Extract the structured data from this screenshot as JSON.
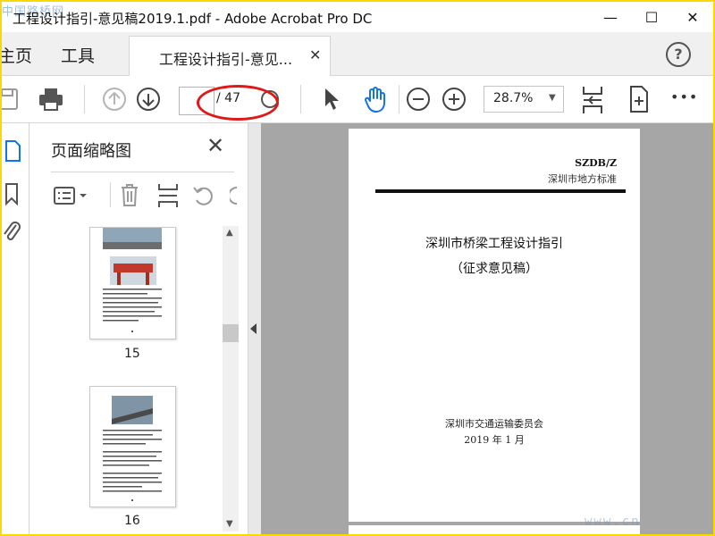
{
  "window": {
    "title": "工程设计指引-意见稿2019.1.pdf - Adobe Acrobat Pro DC",
    "minimize_glyph": "—",
    "maximize_glyph": "☐",
    "close_glyph": "✕",
    "watermark_logo": "中国路桥网"
  },
  "menu": {
    "home": "主页",
    "tools": "工具"
  },
  "tab": {
    "label": "工程设计指引-意见...",
    "close_glyph": "✕"
  },
  "help": {
    "glyph": "?"
  },
  "toolbar": {
    "page_current": "",
    "page_total": "/ 47",
    "zoom": "28.7%",
    "zoom_arrow": "▼",
    "more_glyph": "•••"
  },
  "panel": {
    "title": "页面缩略图",
    "close_glyph": "✕",
    "thumbnails": [
      {
        "label": "15"
      },
      {
        "label": "16"
      }
    ],
    "scroll_up_glyph": "▲",
    "scroll_down_glyph": "▼"
  },
  "document": {
    "code": "SZDB/Z",
    "standard": "深圳市地方标准",
    "title": "深圳市桥梁工程设计指引",
    "subtitle": "（征求意见稿）",
    "org": "深圳市交通运输委员会",
    "date": "2019 年 1 月"
  },
  "watermark_url": "www.cn",
  "colors": {
    "frame": "#f8d900",
    "accent_blue": "#1473e6",
    "annotation_red": "#e01818",
    "doc_background": "#a6a6a6"
  },
  "icons": [
    "save-icon",
    "print-icon",
    "prev-page-icon",
    "next-page-icon",
    "select-arrow-icon",
    "hand-tool-icon",
    "zoom-out-icon",
    "zoom-in-icon",
    "scroll-mode-icon",
    "fit-page-icon",
    "page-options-icon",
    "delete-icon",
    "extract-icon",
    "rotate-icon",
    "thumbnails-icon",
    "bookmark-icon",
    "attachment-icon"
  ]
}
